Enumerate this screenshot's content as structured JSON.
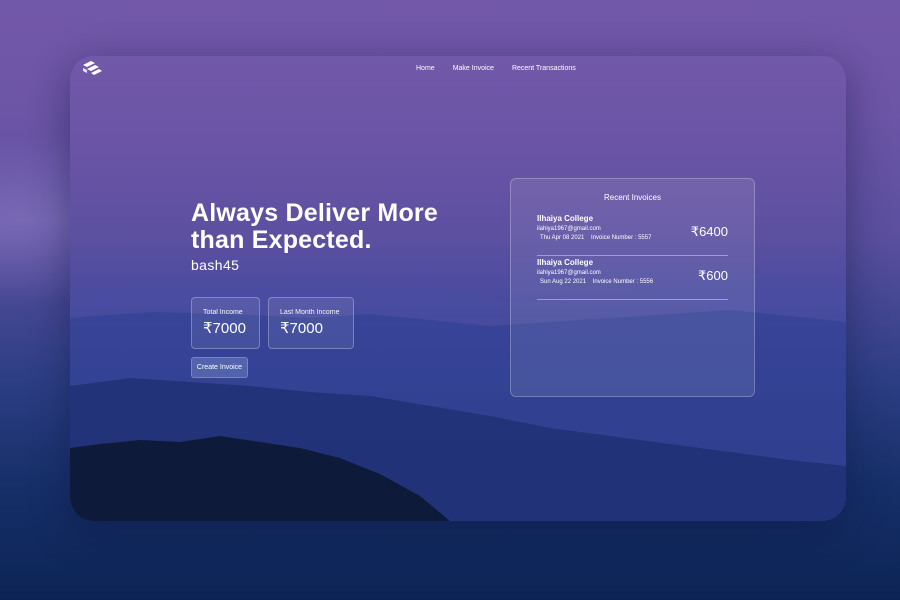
{
  "colors": {
    "page_top": "#7358a8",
    "page_bottom": "#0c2455",
    "card_top": "#7258a9",
    "card_bottom": "#11234f",
    "text": "#ffffff"
  },
  "header": {
    "logo_icon": "stacked-layers-logo",
    "nav": [
      {
        "label": "Home"
      },
      {
        "label": "Make Invoice"
      },
      {
        "label": "Recent Transactions"
      }
    ]
  },
  "hero": {
    "title": "Always Deliver More than Expected.",
    "username": "bash45"
  },
  "stats": [
    {
      "label": "Total Income",
      "value": "₹7000"
    },
    {
      "label": "Last Month Income",
      "value": "₹7000"
    }
  ],
  "actions": {
    "create_invoice_label": "Create Invoice"
  },
  "recent_invoices": {
    "title": "Recent Invoices",
    "items": [
      {
        "name": "Ilhaiya College",
        "email": "ilahiya1967@gmail.com",
        "date": "Thu Apr 08 2021",
        "invoice_number": "Invoice Number : 5557",
        "amount": "₹6400"
      },
      {
        "name": "Ilhaiya College",
        "email": "ilahiya1967@gmail.com",
        "date": "Sun Aug 22 2021",
        "invoice_number": "Invoice Number : 5556",
        "amount": "₹600"
      }
    ]
  }
}
